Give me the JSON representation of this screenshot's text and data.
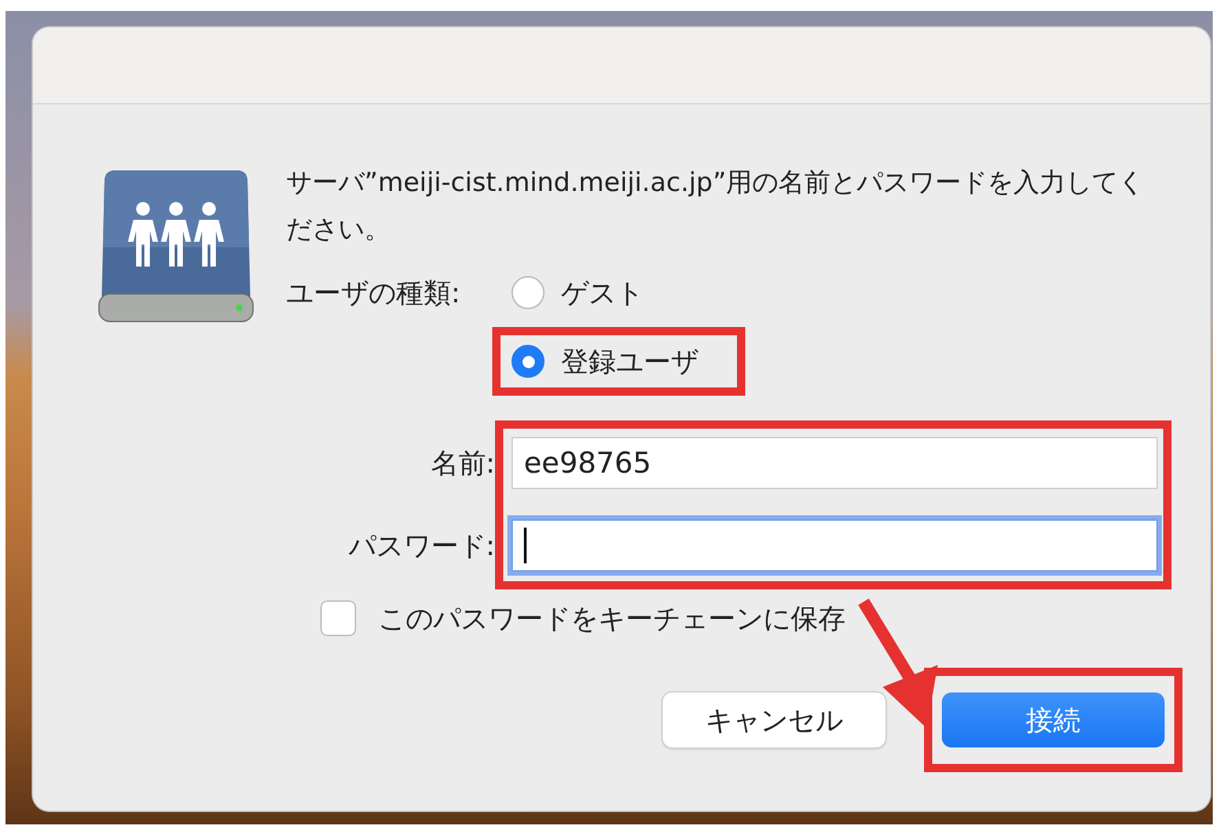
{
  "dialog": {
    "message": "サーバ”meiji-cist.mind.meiji.ac.jp”用の名前とパスワードを入力してください。",
    "user_type": {
      "label": "ユーザの種類:",
      "options": [
        {
          "label": "ゲスト",
          "selected": false,
          "highlighted": false
        },
        {
          "label": "登録ユーザ",
          "selected": true,
          "highlighted": true
        }
      ]
    },
    "fields_highlighted": true,
    "fields": [
      {
        "kind": "text",
        "label": "名前:",
        "value": "ee98765",
        "focused": false
      },
      {
        "kind": "password",
        "label": "パスワード:",
        "focused": true
      }
    ],
    "keychain": {
      "label": "このパスワードをキーチェーンに保存",
      "checked": false
    },
    "buttons": [
      {
        "kind": "secondary",
        "label": "キャンセル",
        "highlighted": false
      },
      {
        "kind": "default",
        "label": "接続",
        "highlighted": true
      }
    ],
    "annotation_arrow": true
  }
}
